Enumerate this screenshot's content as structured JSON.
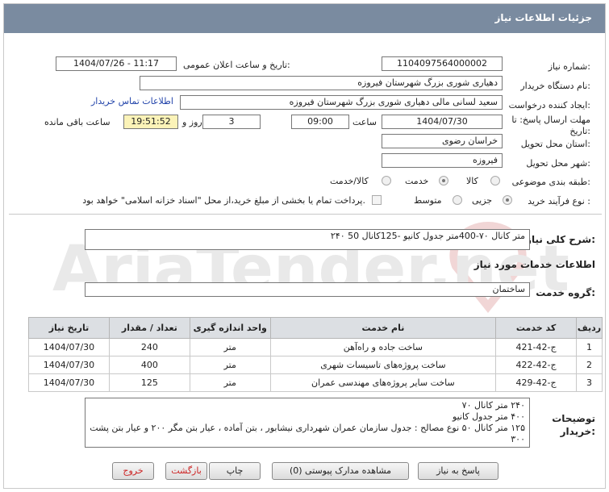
{
  "header": {
    "title": "جزئیات اطلاعات نیاز"
  },
  "form": {
    "need_number_label": "شماره نیاز:",
    "need_number": "1104097564000002",
    "announce_label": "تاریخ و ساعت اعلان عمومی:",
    "announce_value": "1404/07/26 - 11:17",
    "buyer_org_label": "نام دستگاه خریدار:",
    "buyer_org": "دهیاری شوری بزرگ  شهرستان فیروزه",
    "requester_label": "ایجاد کننده درخواست:",
    "requester": "سعید لسانی مالی دهیاری شوری بزرگ  شهرستان فیروزه",
    "contact_link": "اطلاعات تماس خریدار",
    "deadline_label": "مهلت ارسال پاسخ: تا تاریخ:",
    "deadline_date": "1404/07/30",
    "time_label": "ساعت",
    "deadline_time": "09:00",
    "days_value": "3",
    "days_label": "روز و",
    "remaining_time": "19:51:52",
    "remaining_label": "ساعت باقی مانده",
    "province_label": "استان محل تحویل:",
    "province": "خراسان رضوی",
    "city_label": "شهر محل تحویل:",
    "city": "فیروزه",
    "category_label": "طبقه بندی موضوعی:",
    "category_options": [
      "کالا",
      "خدمت",
      "کالا/خدمت"
    ],
    "process_label": "نوع فرآیند خرید :",
    "process_options": [
      "جزیی",
      "متوسط"
    ],
    "payment_note": "پرداخت تمام یا بخشی از مبلغ خرید،از محل \"اسناد خزانه اسلامی\" خواهد بود."
  },
  "summary": {
    "label": "شرح کلی نیاز:",
    "value": "۲۴۰ متر کانال ۷۰-400متر جدول کانیو -125کانال 50"
  },
  "services": {
    "section_title": "اطلاعات خدمات مورد نیاز",
    "group_label": "گروه خدمت:",
    "group_value": "ساختمان",
    "columns": [
      "ردیف",
      "کد خدمت",
      "نام خدمت",
      "واحد اندازه گیری",
      "تعداد / مقدار",
      "تاریخ نیاز"
    ],
    "rows": [
      {
        "idx": "1",
        "code": "ج-42-421",
        "name": "ساخت جاده و راه‌آهن",
        "unit": "متر",
        "qty": "240",
        "date": "1404/07/30"
      },
      {
        "idx": "2",
        "code": "ج-42-422",
        "name": "ساخت پروژه‌های تاسیسات شهری",
        "unit": "متر",
        "qty": "400",
        "date": "1404/07/30"
      },
      {
        "idx": "3",
        "code": "ج-42-429",
        "name": "ساخت سایر پروژه‌های مهندسی عمران",
        "unit": "متر",
        "qty": "125",
        "date": "1404/07/30"
      }
    ]
  },
  "notes": {
    "label": "توضیحات خریدار:",
    "lines": [
      "۲۴۰ متر کانال ۷۰",
      "۴۰۰ متر جدول کانیو",
      "۱۲۵ متر کانال ۵۰ نوع مصالح : جدول سازمان عمران شهرداری نیشابور ، بتن آماده ، عیار بتن مگر ۲۰۰ و عیار بتن پشت بند",
      "۳۰۰"
    ]
  },
  "buttons": {
    "reply": "پاسخ به نیاز",
    "attachments": "مشاهده مدارک پیوستی (0)",
    "print": "چاپ",
    "back": "بازگشت",
    "exit": "خروج"
  },
  "watermark": {
    "text": "AriaTender.net"
  },
  "colors": {
    "header_bg": "#7a8ba0",
    "timer_bg": "#fbf3b8",
    "link": "#2244aa"
  }
}
